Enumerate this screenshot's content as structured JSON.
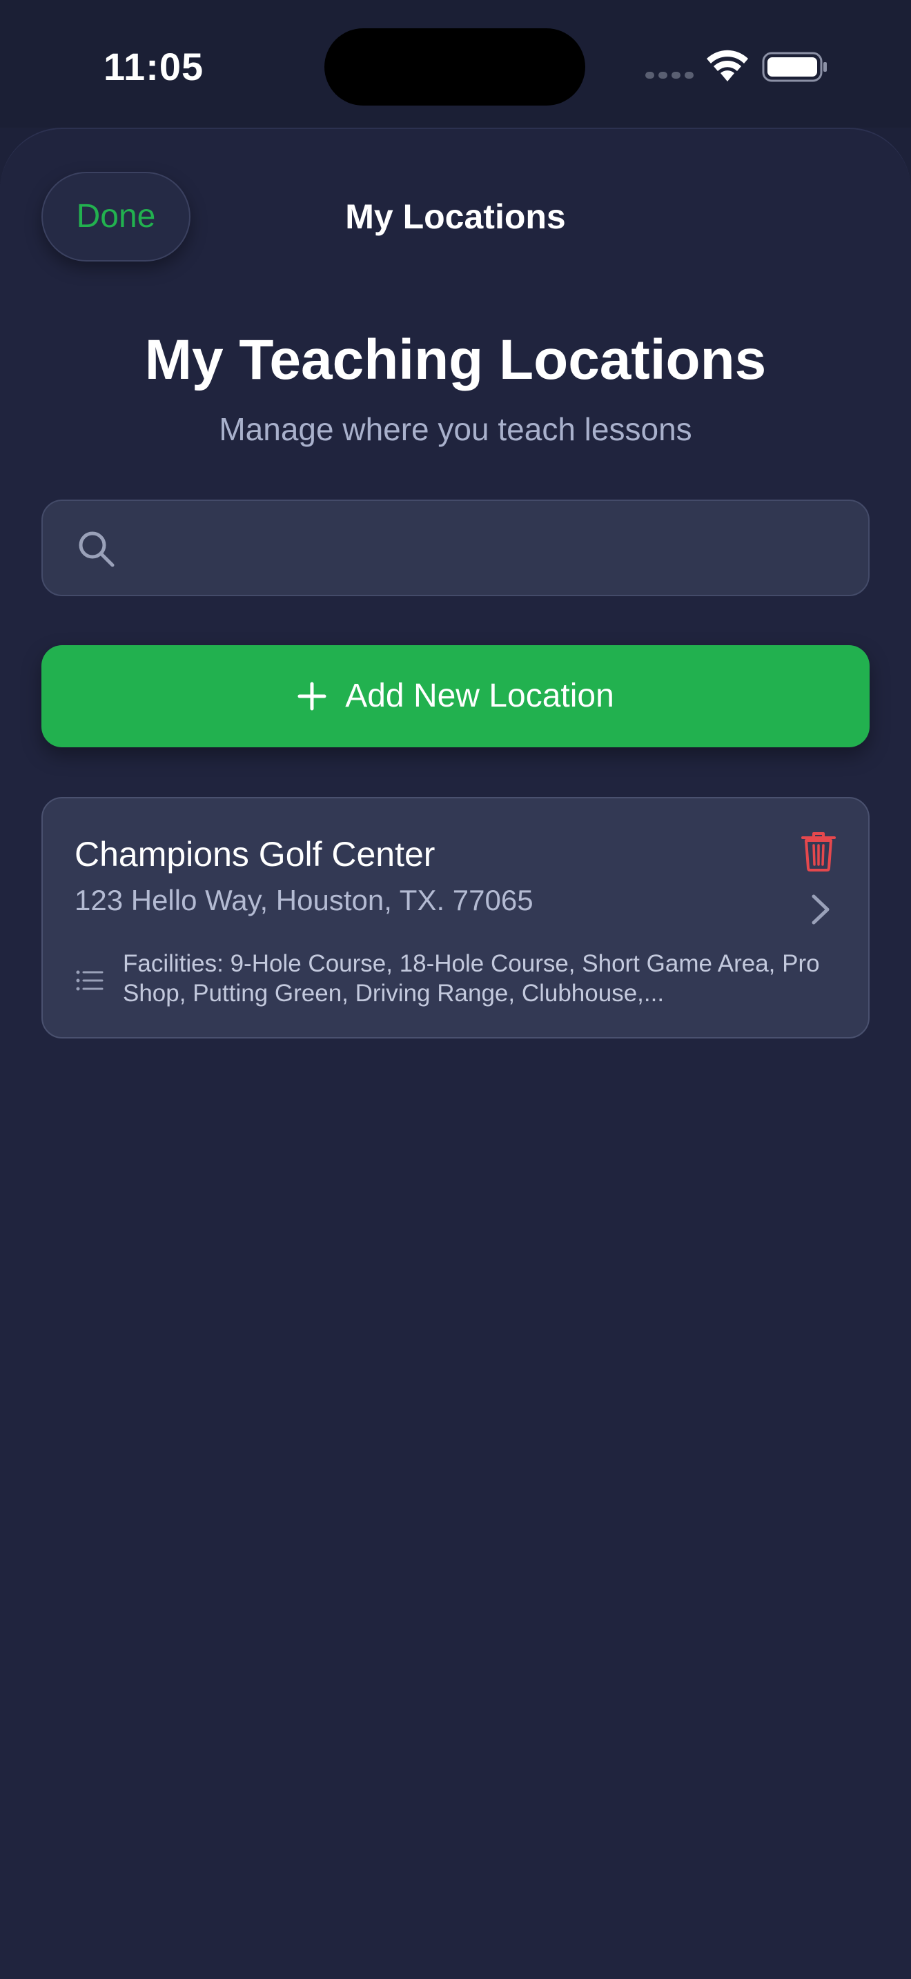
{
  "status_bar": {
    "time": "11:05"
  },
  "nav": {
    "done_label": "Done",
    "title": "My Locations"
  },
  "header": {
    "title": "My Teaching Locations",
    "subtitle": "Manage where you teach lessons"
  },
  "search": {
    "placeholder": "",
    "value": ""
  },
  "actions": {
    "add_label": "Add New Location"
  },
  "locations": [
    {
      "name": "Champions Golf Center",
      "address": "123 Hello Way, Houston, TX. 77065",
      "facilities": "Facilities: 9-Hole Course, 18-Hole Course, Short Game Area, Pro Shop, Putting Green, Driving Range, Clubhouse,..."
    }
  ],
  "colors": {
    "background": "#1d2139",
    "sheet": "#20243e",
    "accent_green": "#22b14f",
    "card": "#333954",
    "delete_red": "#e5484d"
  },
  "icons": [
    "wifi-icon",
    "battery-icon",
    "search-icon",
    "plus-icon",
    "trash-icon",
    "chevron-right-icon",
    "list-icon"
  ]
}
